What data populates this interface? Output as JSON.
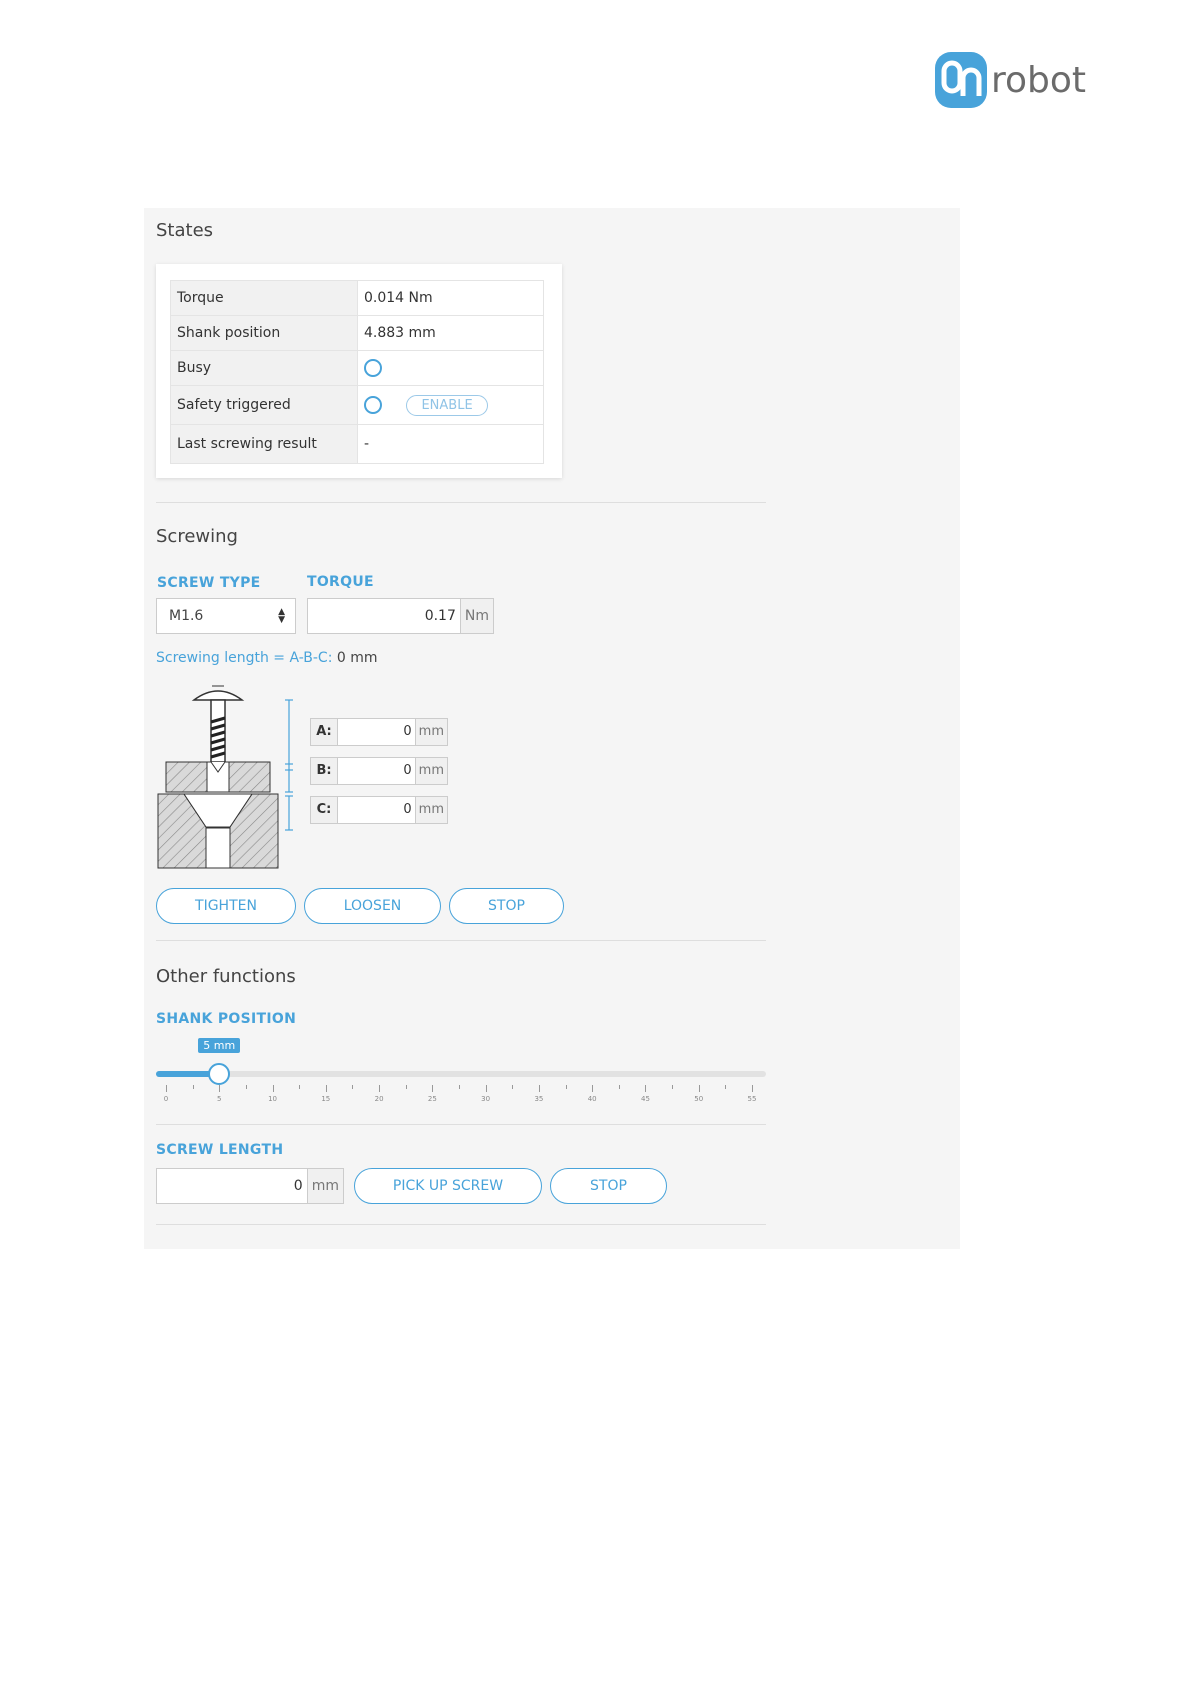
{
  "logo": {
    "text": "robot",
    "badge_color": "#48a3da"
  },
  "states": {
    "title": "States",
    "rows": [
      {
        "label": "Torque",
        "value": "0.014 Nm"
      },
      {
        "label": "Shank position",
        "value": "4.883 mm"
      },
      {
        "label": "Busy",
        "value": ""
      },
      {
        "label": "Safety triggered",
        "value": ""
      },
      {
        "label": "Last screwing result",
        "value": "-"
      }
    ],
    "enable_label": "ENABLE"
  },
  "screwing": {
    "title": "Screwing",
    "screw_type_label": "SCREW TYPE",
    "screw_type_value": "M1.6",
    "torque_label": "TORQUE",
    "torque_value": "0.17",
    "torque_unit": "Nm",
    "formula_label": "Screwing length = A-B-C:",
    "formula_result": "0 mm",
    "dims": [
      {
        "label": "A:",
        "value": "0",
        "unit": "mm"
      },
      {
        "label": "B:",
        "value": "0",
        "unit": "mm"
      },
      {
        "label": "C:",
        "value": "0",
        "unit": "mm"
      }
    ],
    "buttons": {
      "tighten": "TIGHTEN",
      "loosen": "LOOSEN",
      "stop": "STOP"
    }
  },
  "other": {
    "title": "Other functions",
    "shank_label": "SHANK POSITION",
    "shank_value": 5,
    "shank_bubble": "5 mm",
    "slider_min": 0,
    "slider_max": 55,
    "tick_labels": [
      "0",
      "5",
      "10",
      "15",
      "20",
      "25",
      "30",
      "35",
      "40",
      "45",
      "50",
      "55"
    ],
    "screw_length_label": "SCREW LENGTH",
    "screw_length_value": "0",
    "screw_length_unit": "mm",
    "pick_up_label": "PICK UP SCREW",
    "stop_label": "STOP"
  },
  "colors": {
    "accent": "#48a3da",
    "panel_bg": "#f5f5f5"
  }
}
